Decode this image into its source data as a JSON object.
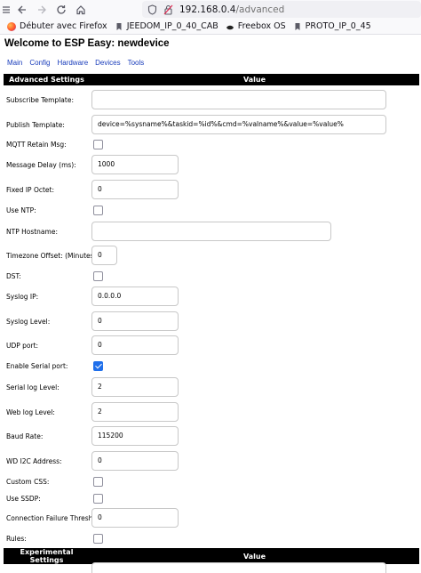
{
  "browser": {
    "url_host": "192.168.0.4",
    "url_path": "/advanced",
    "bookmarks": [
      {
        "label": "Débuter avec Firefox",
        "icon": "firefox-icon"
      },
      {
        "label": "JEEDOM_IP_0_40_CAB",
        "icon": "bookmark-icon"
      },
      {
        "label": "Freebox OS",
        "icon": "freebox-icon"
      },
      {
        "label": "PROTO_IP_0_45",
        "icon": "bookmark-icon"
      }
    ]
  },
  "page": {
    "title": "Welcome to ESP Easy: newdevice",
    "menu": [
      "Main",
      "Config",
      "Hardware",
      "Devices",
      "Tools"
    ]
  },
  "advanced": {
    "header_left": "Advanced Settings",
    "header_right": "Value",
    "rows": [
      {
        "label": "Subscribe Template:",
        "value": ""
      },
      {
        "label": "Publish Template:",
        "value": "device=%sysname%&taskid=%id%&cmd=%valname%&value=%value%"
      },
      {
        "label": "MQTT Retain Msg:",
        "checked": false
      },
      {
        "label": "Message Delay (ms):",
        "value": "1000"
      },
      {
        "label": "Fixed IP Octet:",
        "value": "0"
      },
      {
        "label": "Use NTP:",
        "checked": false
      },
      {
        "label": "NTP Hostname:",
        "value": ""
      },
      {
        "label": "Timezone Offset: (Minutes)",
        "value": "0"
      },
      {
        "label": "DST:",
        "checked": false
      },
      {
        "label": "Syslog IP:",
        "value": "0.0.0.0"
      },
      {
        "label": "Syslog Level:",
        "value": "0"
      },
      {
        "label": "UDP port:",
        "value": "0"
      },
      {
        "label": "Enable Serial port:",
        "checked": true
      },
      {
        "label": "Serial log Level:",
        "value": "2"
      },
      {
        "label": "Web log Level:",
        "value": "2"
      },
      {
        "label": "Baud Rate:",
        "value": "115200"
      },
      {
        "label": "WD I2C Address:",
        "value": "0"
      },
      {
        "label": "Custom CSS:",
        "checked": false
      },
      {
        "label": "Use SSDP:",
        "checked": false
      },
      {
        "label": "Connection Failure Threshold:",
        "value": "0"
      },
      {
        "label": "Rules:",
        "checked": false
      }
    ]
  },
  "experimental": {
    "header_left": "Experimental Settings",
    "header_right": "Value"
  },
  "colors": {
    "accent_checkbox": "#1f6feb",
    "header_bg": "#000000",
    "link": "#1a3dbb"
  }
}
